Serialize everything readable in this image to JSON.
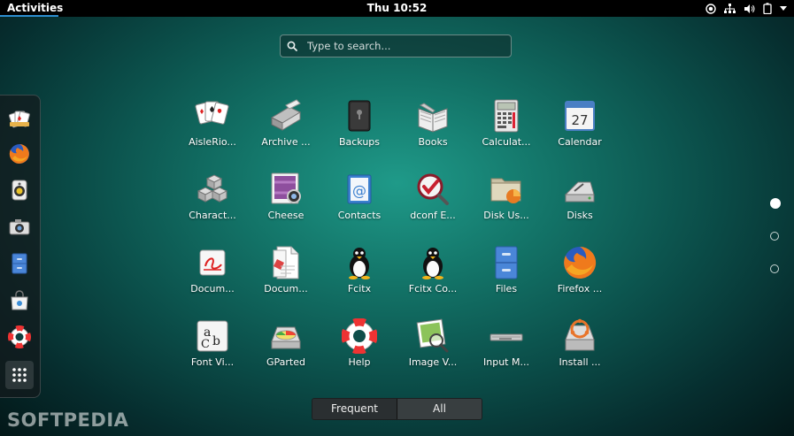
{
  "topbar": {
    "activities_label": "Activities",
    "clock": "Thu 10:52",
    "tray_icons": [
      "accessibility-icon",
      "network-icon",
      "volume-icon",
      "battery-icon",
      "menu-arrow-icon"
    ]
  },
  "search": {
    "placeholder": "Type to search..."
  },
  "dash": {
    "items": [
      {
        "name": "aisleriot-solitaire",
        "icon": "cards-icon"
      },
      {
        "name": "firefox",
        "icon": "firefox-icon"
      },
      {
        "name": "rhythmbox",
        "icon": "speaker-icon"
      },
      {
        "name": "cheese",
        "icon": "camera-icon"
      },
      {
        "name": "files",
        "icon": "file-cabinet-icon"
      },
      {
        "name": "software",
        "icon": "shopping-bag-icon"
      },
      {
        "name": "help",
        "icon": "lifebuoy-icon"
      },
      {
        "name": "show-applications",
        "icon": "app-grid-icon"
      }
    ]
  },
  "apps": [
    {
      "label": "AisleRio...",
      "icon": "cards-icon"
    },
    {
      "label": "Archive ...",
      "icon": "archive-icon"
    },
    {
      "label": "Backups",
      "icon": "safe-icon"
    },
    {
      "label": "Books",
      "icon": "book-icon"
    },
    {
      "label": "Calculat...",
      "icon": "calculator-icon"
    },
    {
      "label": "Calendar",
      "icon": "calendar-icon",
      "calendar_day": "27"
    },
    {
      "label": "Charact...",
      "icon": "character-blocks-icon"
    },
    {
      "label": "Cheese",
      "icon": "cheese-camera-icon"
    },
    {
      "label": "Contacts",
      "icon": "contacts-icon"
    },
    {
      "label": "dconf E...",
      "icon": "dconf-icon"
    },
    {
      "label": "Disk Us...",
      "icon": "folder-chart-icon"
    },
    {
      "label": "Disks",
      "icon": "disks-icon"
    },
    {
      "label": "Docum...",
      "icon": "document-viewer-icon"
    },
    {
      "label": "Docum...",
      "icon": "documents-icon"
    },
    {
      "label": "Fcitx",
      "icon": "penguin-icon"
    },
    {
      "label": "Fcitx Co...",
      "icon": "penguin-config-icon"
    },
    {
      "label": "Files",
      "icon": "file-cabinet-icon"
    },
    {
      "label": "Firefox ...",
      "icon": "firefox-icon"
    },
    {
      "label": "Font Vi...",
      "icon": "font-icon"
    },
    {
      "label": "GParted",
      "icon": "gparted-icon"
    },
    {
      "label": "Help",
      "icon": "lifebuoy-icon"
    },
    {
      "label": "Image V...",
      "icon": "image-viewer-icon"
    },
    {
      "label": "Input M...",
      "icon": "keyboard-icon"
    },
    {
      "label": "Install ...",
      "icon": "installer-icon"
    }
  ],
  "pagination": {
    "pages": 3,
    "current": 1
  },
  "view_toggle": {
    "frequent_label": "Frequent",
    "all_label": "All",
    "selected": "All"
  },
  "watermark": "SOFTPEDIA"
}
